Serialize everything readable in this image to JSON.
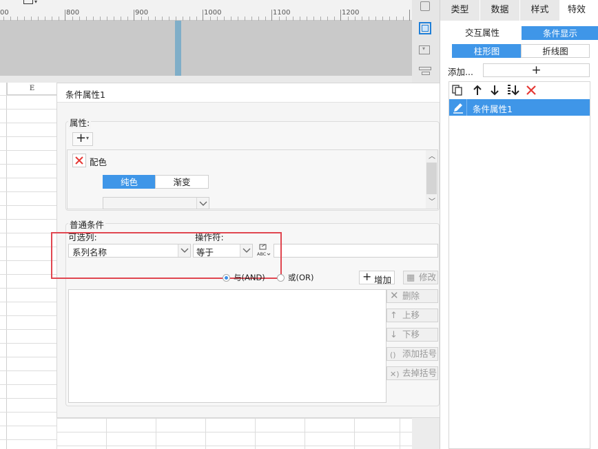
{
  "ruler": {
    "ticks": [
      "00",
      "800",
      "900",
      "1000",
      "1100",
      "1200"
    ]
  },
  "sheet": {
    "column_header": "E"
  },
  "right_panel": {
    "tabs": [
      "类型",
      "数据",
      "样式",
      "特效"
    ],
    "sub_tabs": {
      "interaction": "交互属性",
      "condition": "条件显示"
    },
    "chart_tabs": {
      "bar": "柱形图",
      "line": "折线图"
    },
    "add_label": "添加...",
    "add_button": "+",
    "list_items": [
      "条件属性1"
    ]
  },
  "dialog": {
    "title": "条件属性1",
    "attribute": {
      "section_label": "属性:",
      "add_button": "+",
      "item_label": "配色",
      "color_tabs": {
        "solid": "纯色",
        "gradient": "渐变"
      }
    },
    "conditions": {
      "section_label": "普通条件",
      "column_label": "可选列:",
      "operator_label": "操作符:",
      "column_value": "系列名称",
      "operator_value": "等于",
      "value_input": "",
      "and_label": "与(AND)",
      "or_label": "或(OR)",
      "add_button": "增加",
      "modify_button": "修改",
      "delete_button": "删除",
      "up_button": "上移",
      "down_button": "下移",
      "add_bracket_button": "添加括号",
      "remove_bracket_button": "去掉括号"
    }
  },
  "colors": {
    "accent": "#3f96e8",
    "highlight_box": "#e0454f",
    "delete_red": "#e53935"
  },
  "icons": [
    "copy-icon",
    "arrow-up-icon",
    "arrow-down-icon",
    "move-bottom-icon",
    "delete-icon",
    "pencil-icon",
    "formula-icon"
  ]
}
